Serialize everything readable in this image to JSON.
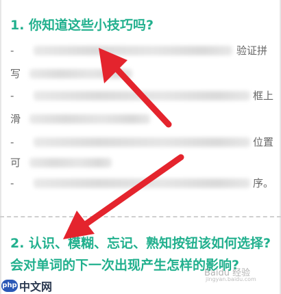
{
  "section1": {
    "heading": "1. 你知道这些小技巧吗?"
  },
  "tips": [
    {
      "lead": "-",
      "tail": "验证拼"
    },
    {
      "lead": "写",
      "tail": ""
    },
    {
      "lead": "-",
      "tail": "框上"
    },
    {
      "lead": "滑",
      "tail": ""
    },
    {
      "lead": "-",
      "tail": "位置"
    },
    {
      "lead": "可",
      "tail": ""
    },
    {
      "lead": "-",
      "tail": "序。"
    }
  ],
  "section2": {
    "heading": "2. 认识、模糊、忘记、熟知按钮该如何选择?会对单词的下一次出现产生怎样的影响?"
  },
  "watermarks": {
    "php_badge": "php",
    "php_site": "中文网",
    "baidu": "Baidu 经验",
    "baidu_url": "jingyan.baidu.com"
  },
  "colors": {
    "heading": "#22b08e",
    "arrow": "#e4242d"
  },
  "icons": {
    "arrow": "red-arrow-icon"
  }
}
